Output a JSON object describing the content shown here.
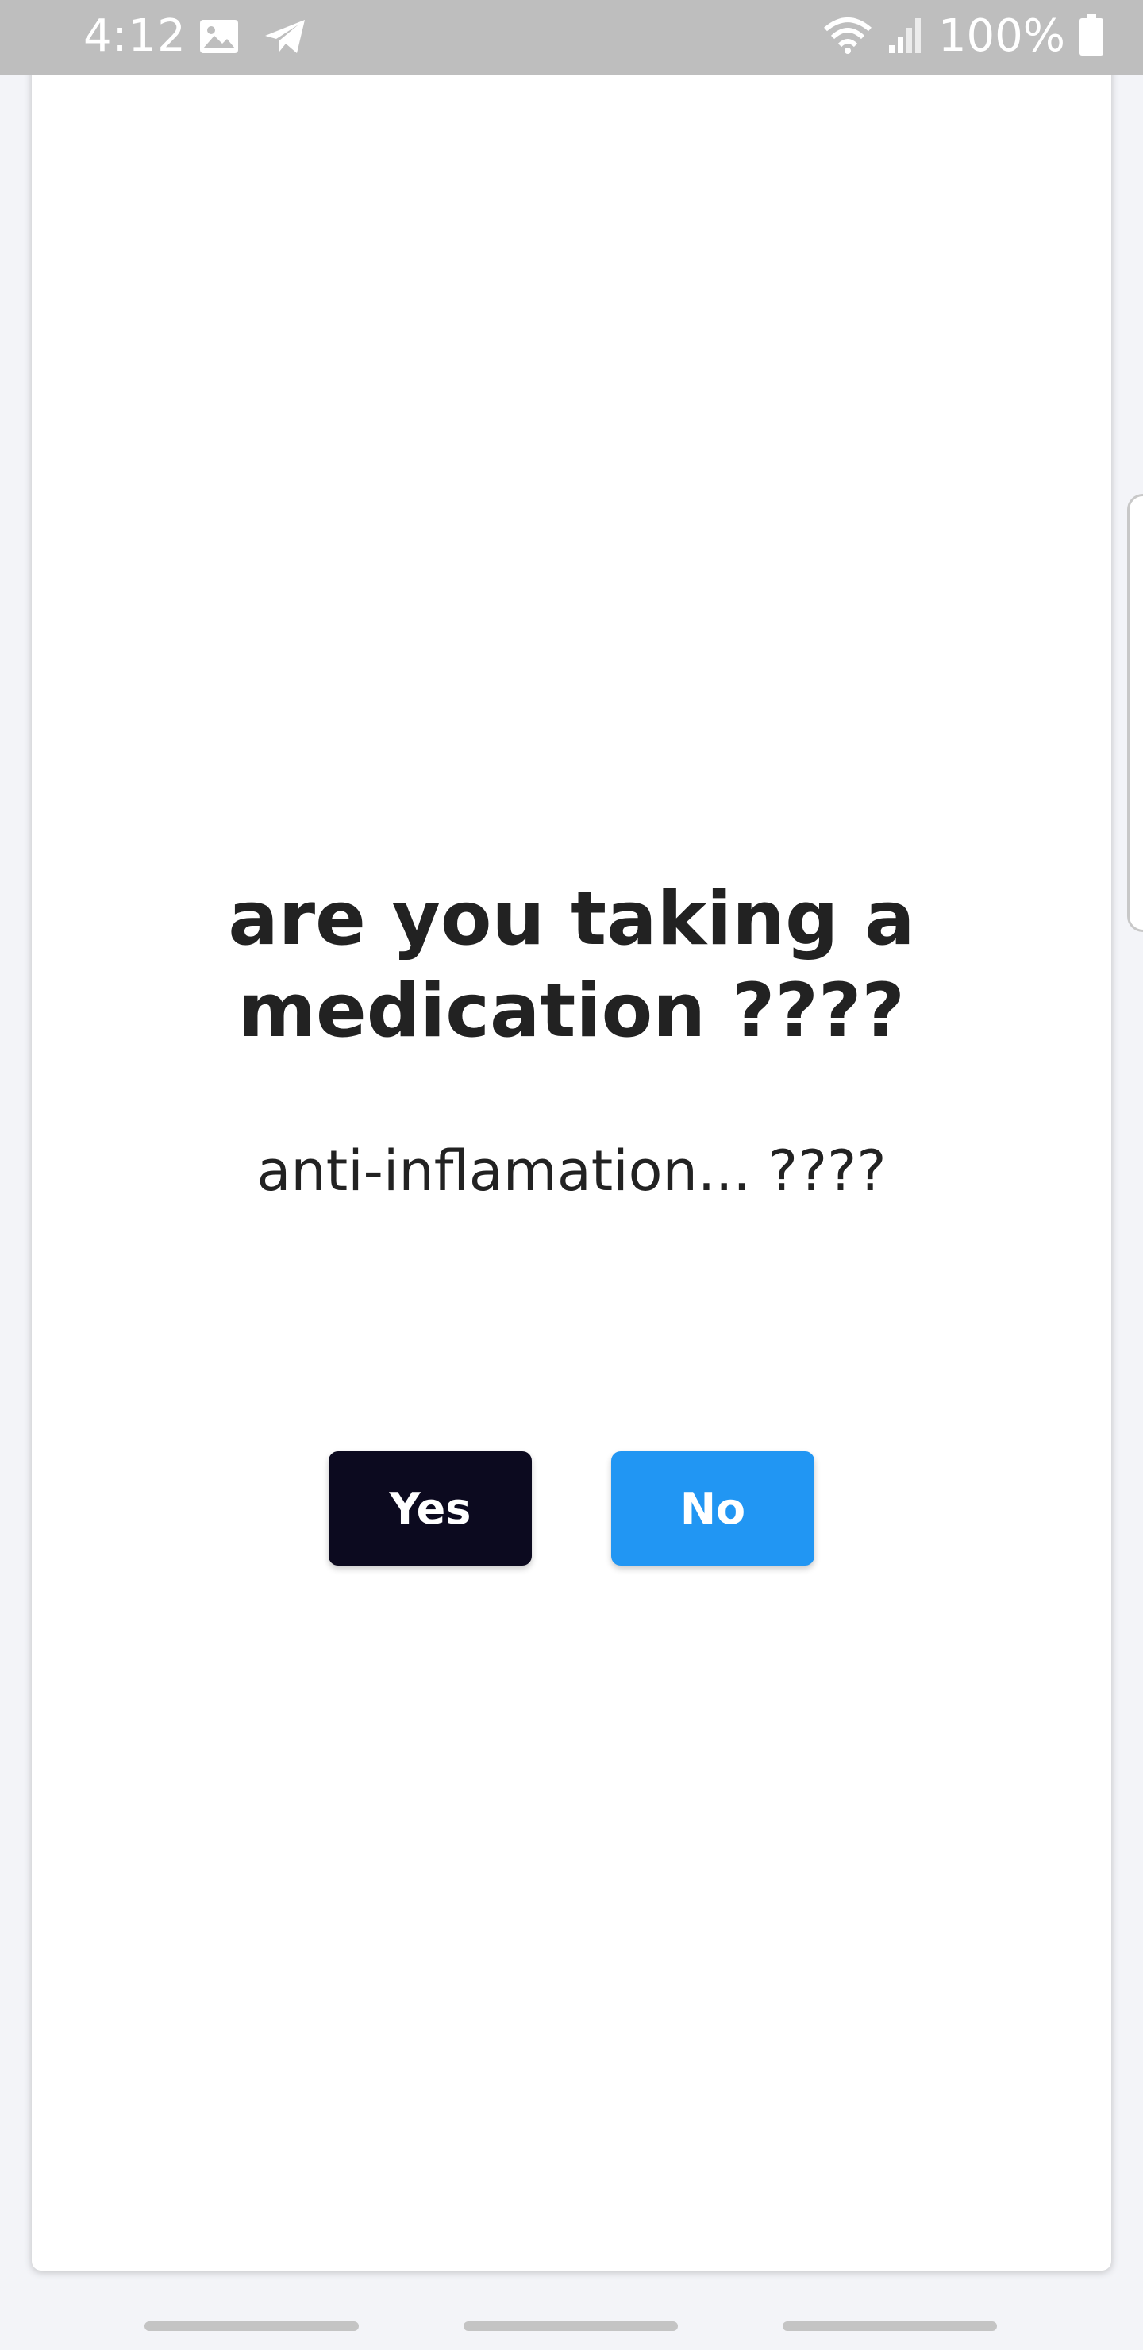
{
  "status_bar": {
    "time": "4:12",
    "battery": "100%",
    "icons": [
      "image-icon",
      "telegram-icon",
      "wifi-icon",
      "signal-icon",
      "battery-icon"
    ]
  },
  "question": {
    "title": "are you taking a medication ????",
    "subtitle": "anti-inflamation... ????"
  },
  "buttons": {
    "yes_label": "Yes",
    "no_label": "No"
  },
  "colors": {
    "yes_button": "#0c0a1f",
    "no_button": "#2196f3",
    "text": "#222222",
    "status_bar": "#bebebe"
  }
}
